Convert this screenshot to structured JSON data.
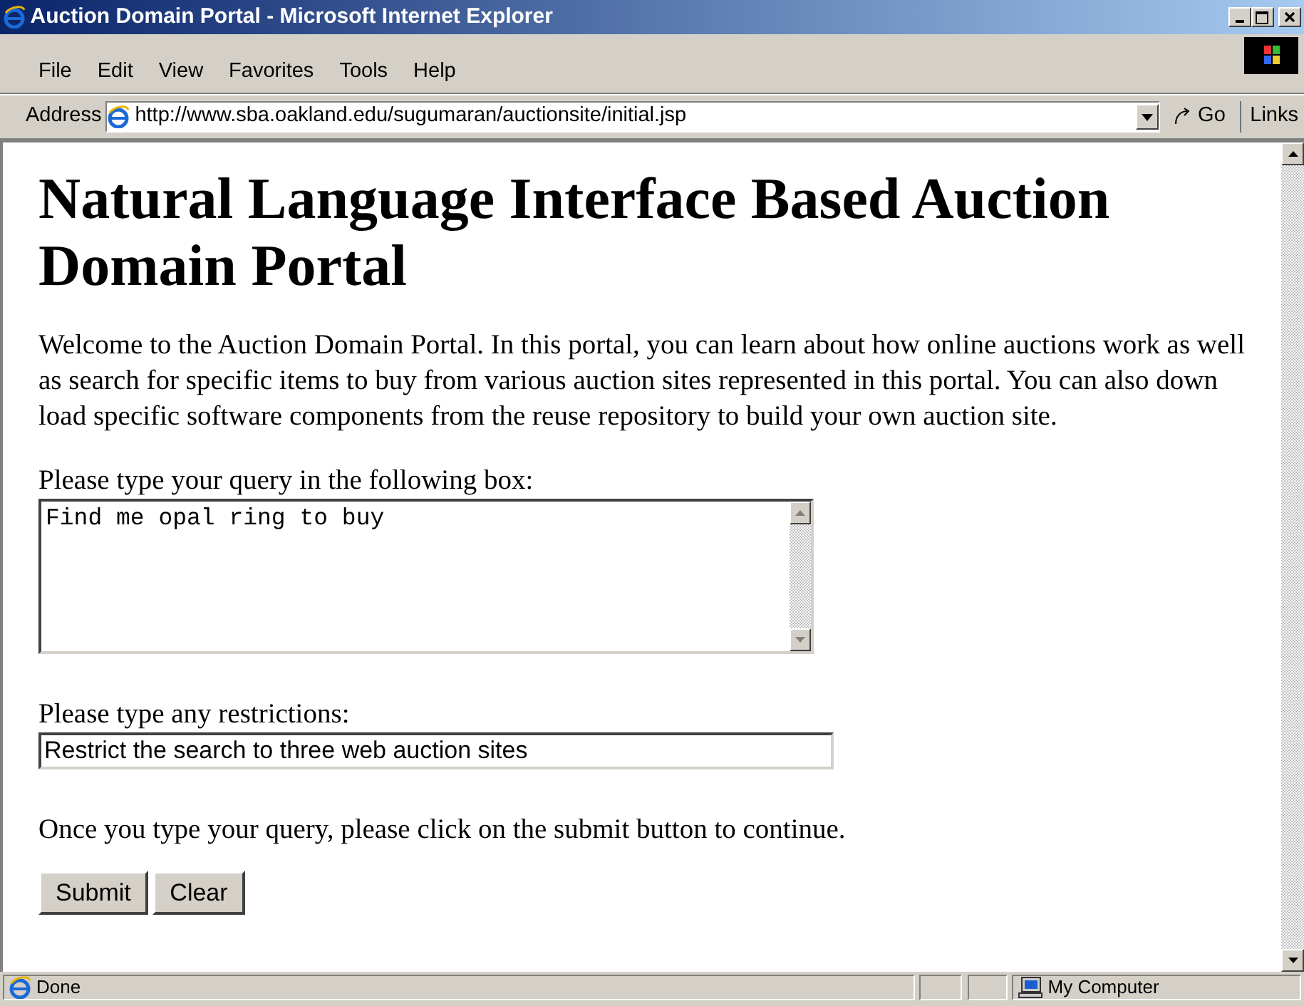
{
  "window": {
    "title": "Auction Domain Portal - Microsoft Internet Explorer"
  },
  "menu": [
    "File",
    "Edit",
    "View",
    "Favorites",
    "Tools",
    "Help"
  ],
  "address_bar": {
    "label": "Address",
    "url": "http://www.sba.oakland.edu/sugumaran/auctionsite/initial.jsp",
    "go": "Go",
    "links": "Links"
  },
  "page": {
    "heading": "Natural Language Interface Based Auction Domain Portal",
    "intro": "Welcome to the Auction Domain Portal. In this portal, you can learn about how online auctions work as well as search for specific items to buy from various auction sites represented in this portal. You can also down load specific software components from the reuse repository to build your own auction site.",
    "query_label": "Please type your query in the following box:",
    "query_value": "Find me opal ring to buy",
    "restrictions_label": "Please type any restrictions:",
    "restrictions_value": "Restrict the search to three web auction sites",
    "instruction": "Once you type your query, please click on the submit button to continue.",
    "buttons": [
      "Submit",
      "Clear"
    ]
  },
  "status_bar": {
    "text": "Done",
    "zone": "My Computer"
  }
}
